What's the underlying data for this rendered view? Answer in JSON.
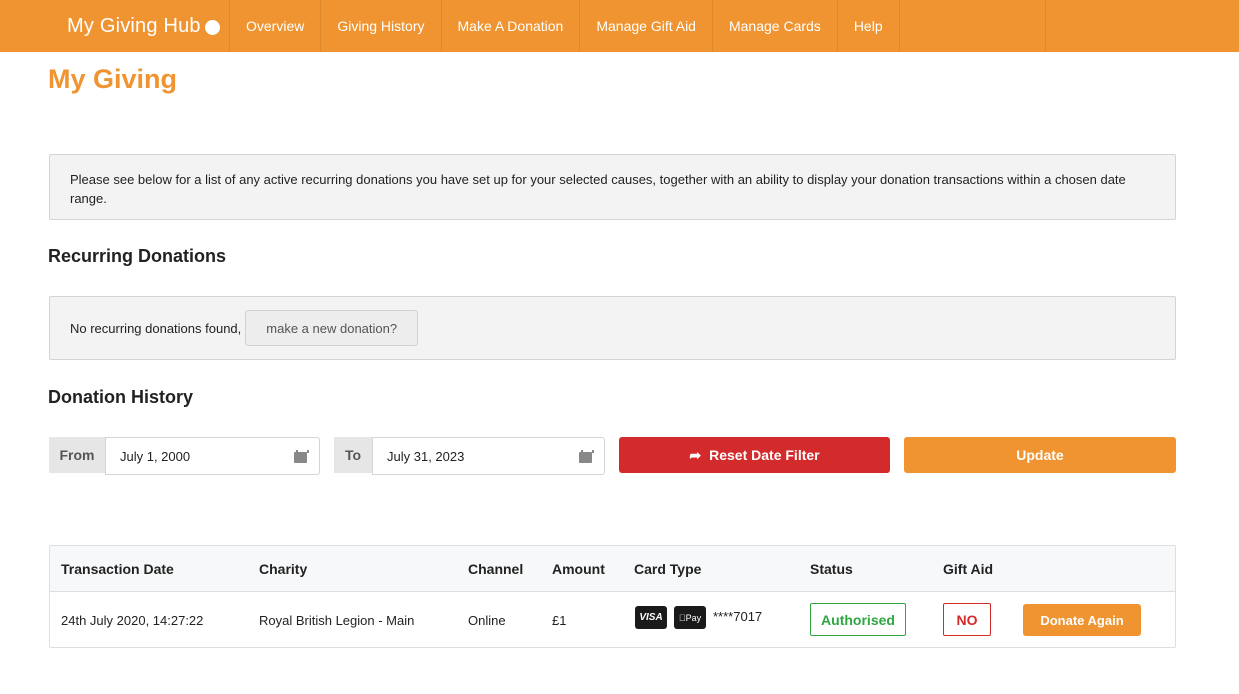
{
  "nav": {
    "brand": "My Giving Hub",
    "items": [
      {
        "label": "Overview"
      },
      {
        "label": "Giving History"
      },
      {
        "label": "Make A Donation"
      },
      {
        "label": "Manage Gift Aid"
      },
      {
        "label": "Manage Cards"
      },
      {
        "label": "Help"
      }
    ]
  },
  "page": {
    "title": "My Giving",
    "info": "Please see below for a list of any active recurring donations you have set up for your selected causes, together with an ability to display your donation transactions within a chosen date range."
  },
  "recurring": {
    "title": "Recurring Donations",
    "empty_text": "No recurring donations found,",
    "new_donation_label": "make a new donation?"
  },
  "history": {
    "title": "Donation History",
    "from_label": "From",
    "from_value": "July 1, 2000",
    "to_label": "To",
    "to_value": "July 31, 2023",
    "reset_label": "Reset Date Filter",
    "update_label": "Update",
    "columns": [
      "Transaction Date",
      "Charity",
      "Channel",
      "Amount",
      "Card Type",
      "Status",
      "Gift Aid"
    ],
    "rows": [
      {
        "date": "24th July 2020, 14:27:22",
        "charity": "Royal British Legion - Main",
        "channel": "Online",
        "amount": "£1",
        "card_brand": "VISA",
        "wallet": "Pay",
        "card_number": "****7017",
        "status": "Authorised",
        "gift_aid": "NO",
        "action": "Donate Again"
      }
    ]
  },
  "colors": {
    "accent": "#ef9430",
    "danger": "#d32a2c",
    "success": "#2fa642"
  }
}
